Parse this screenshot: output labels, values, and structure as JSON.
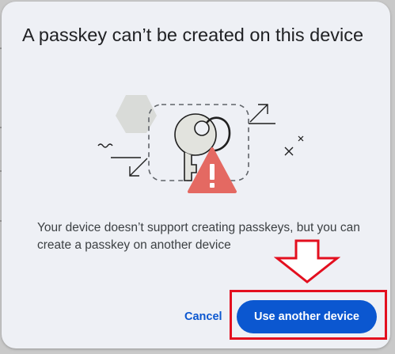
{
  "dialog": {
    "title": "A passkey can’t be created on this device",
    "message": "Your device doesn’t support creating passkeys, but you can create a passkey on another device",
    "cancel_label": "Cancel",
    "primary_label": "Use another device"
  },
  "colors": {
    "accent": "#0b57d0",
    "warning": "#e46962",
    "annotation": "#e30f1f",
    "dialog_background": "#eef0f5"
  },
  "icons": {
    "illustration": "passkey-warning-illustration",
    "annotation_arrow": "red-down-arrow-icon"
  }
}
